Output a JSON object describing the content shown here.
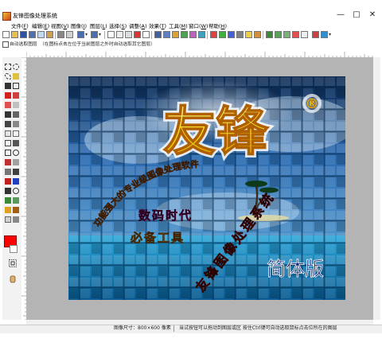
{
  "window": {
    "title": "友锋图像处理系统",
    "minimize_glyph": "—",
    "maximize_glyph": "□",
    "close_glyph": "✕"
  },
  "menu": [
    {
      "label": "文件",
      "key": "F"
    },
    {
      "label": "编辑",
      "key": "E"
    },
    {
      "label": "视图",
      "key": "V"
    },
    {
      "label": "图像",
      "key": "I"
    },
    {
      "label": "图层",
      "key": "L"
    },
    {
      "label": "选择",
      "key": "S"
    },
    {
      "label": "调整",
      "key": "A"
    },
    {
      "label": "效果",
      "key": "T"
    },
    {
      "label": "工具",
      "key": "M"
    },
    {
      "label": "窗口",
      "key": "W"
    },
    {
      "label": "帮助",
      "key": "H"
    }
  ],
  "options_bar": {
    "auto_select_label": "自动选取图层",
    "hint": "（在图标点击左位于当前图层之外时自动选取其它图层）"
  },
  "colors": {
    "foreground": "#ff0000",
    "background": "#ffffff",
    "workspace": "#b4b4b4"
  },
  "canvas": {
    "logo_text": "友锋",
    "registered_mark": "®",
    "arc_text": "功能强大的专业级图像处理软件",
    "slogan_line1": "数码时代",
    "slogan_line2": "必备工具",
    "diagonal_text": "友锋图像处理系统",
    "edition": "简体版"
  },
  "statusbar": {
    "image_size": "图像尺寸：800×600 像素",
    "hint": "当试按钮可以拖动到图层或区 按住Ctrl键可自动选取鼠标点击位所在的图层"
  }
}
